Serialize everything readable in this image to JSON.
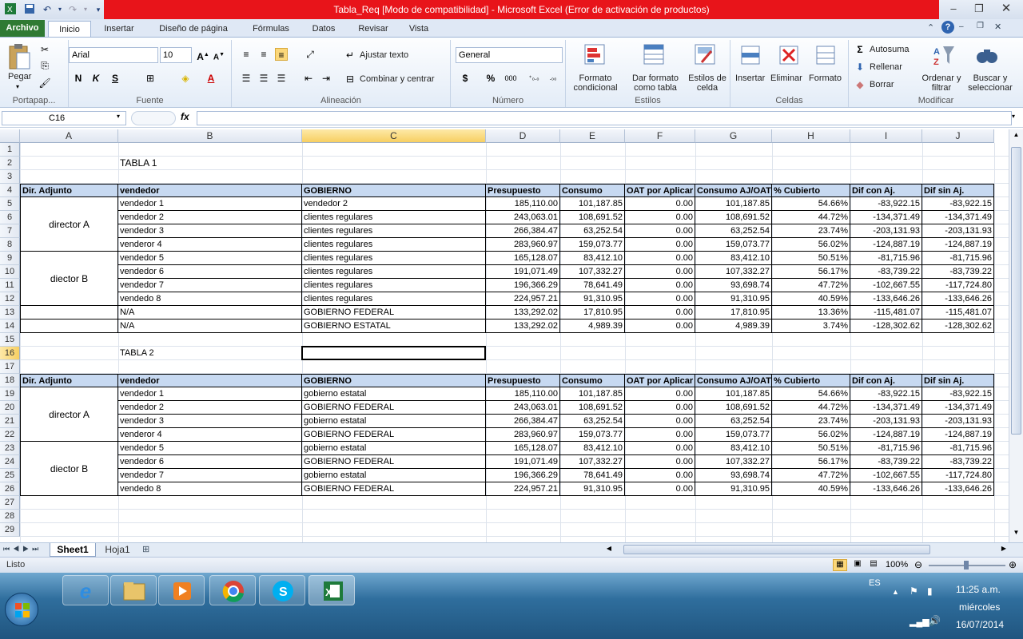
{
  "window": {
    "title": "Tabla_Req  [Modo de compatibilidad]  -  Microsoft Excel (Error de activación de productos)"
  },
  "ribbon_tabs": [
    "Archivo",
    "Inicio",
    "Insertar",
    "Diseño de página",
    "Fórmulas",
    "Datos",
    "Revisar",
    "Vista"
  ],
  "ribbon": {
    "clipboard": {
      "paste": "Pegar",
      "group": "Portapap..."
    },
    "font": {
      "name": "Arial",
      "size": "10",
      "group": "Fuente"
    },
    "alignment": {
      "wrap": "Ajustar texto",
      "merge": "Combinar y centrar",
      "group": "Alineación"
    },
    "number": {
      "format": "General",
      "group": "Número"
    },
    "styles": {
      "cond": "Formato condicional",
      "table": "Dar formato como tabla",
      "cellstyles": "Estilos de celda",
      "group": "Estilos"
    },
    "cells": {
      "insert": "Insertar",
      "delete": "Eliminar",
      "format": "Formato",
      "group": "Celdas"
    },
    "editing": {
      "autosum": "Autosuma",
      "fill": "Rellenar",
      "clear": "Borrar",
      "sort": "Ordenar y filtrar",
      "find": "Buscar y seleccionar",
      "group": "Modificar"
    }
  },
  "formula_bar": {
    "name_box": "C16",
    "fx": "fx",
    "value": ""
  },
  "columns": [
    "A",
    "B",
    "C",
    "D",
    "E",
    "F",
    "G",
    "H",
    "I",
    "J"
  ],
  "rows": [
    "1",
    "2",
    "3",
    "4",
    "5",
    "6",
    "7",
    "8",
    "9",
    "10",
    "11",
    "12",
    "13",
    "14",
    "15",
    "16",
    "17",
    "18",
    "19",
    "20",
    "21",
    "22",
    "23",
    "24",
    "25",
    "26",
    "27",
    "28",
    "29"
  ],
  "sheet": {
    "table1_title": "TABLA 1",
    "table2_title": "TABLA 2",
    "headers": [
      "Dir. Adjunto",
      "vendedor",
      "GOBIERNO",
      "Presupuesto",
      "Consumo",
      "OAT por Aplicar",
      "Consumo AJ/OAT",
      "% Cubierto",
      "Dif con Aj.",
      "Dif sin Aj."
    ],
    "director_a": "director A",
    "director_b1": "diector B",
    "director_b2": "diector B",
    "table1": [
      [
        "vendedor 1",
        "vendedor 2",
        "185,110.00",
        "101,187.85",
        "0.00",
        "101,187.85",
        "54.66%",
        "-83,922.15",
        "-83,922.15"
      ],
      [
        "vendedor 2",
        "clientes regulares",
        "243,063.01",
        "108,691.52",
        "0.00",
        "108,691.52",
        "44.72%",
        "-134,371.49",
        "-134,371.49"
      ],
      [
        "vendedor 3",
        "clientes regulares",
        "266,384.47",
        "63,252.54",
        "0.00",
        "63,252.54",
        "23.74%",
        "-203,131.93",
        "-203,131.93"
      ],
      [
        "venderor 4",
        "clientes regulares",
        "283,960.97",
        "159,073.77",
        "0.00",
        "159,073.77",
        "56.02%",
        "-124,887.19",
        "-124,887.19"
      ],
      [
        "vendedor 5",
        "clientes regulares",
        "165,128.07",
        "83,412.10",
        "0.00",
        "83,412.10",
        "50.51%",
        "-81,715.96",
        "-81,715.96"
      ],
      [
        "vendedor 6",
        "clientes regulares",
        "191,071.49",
        "107,332.27",
        "0.00",
        "107,332.27",
        "56.17%",
        "-83,739.22",
        "-83,739.22"
      ],
      [
        "vendedor 7",
        "clientes regulares",
        "196,366.29",
        "78,641.49",
        "0.00",
        "93,698.74",
        "47.72%",
        "-102,667.55",
        "-117,724.80"
      ],
      [
        "vendedo 8",
        "clientes regulares",
        "224,957.21",
        "91,310.95",
        "0.00",
        "91,310.95",
        "40.59%",
        "-133,646.26",
        "-133,646.26"
      ],
      [
        "N/A",
        "GOBIERNO FEDERAL",
        "133,292.02",
        "17,810.95",
        "0.00",
        "17,810.95",
        "13.36%",
        "-115,481.07",
        "-115,481.07"
      ],
      [
        "N/A",
        "GOBIERNO ESTATAL",
        "133,292.02",
        "4,989.39",
        "0.00",
        "4,989.39",
        "3.74%",
        "-128,302.62",
        "-128,302.62"
      ]
    ],
    "table2": [
      [
        "vendedor 1",
        "gobierno estatal",
        "185,110.00",
        "101,187.85",
        "0.00",
        "101,187.85",
        "54.66%",
        "-83,922.15",
        "-83,922.15"
      ],
      [
        "vendedor 2",
        "GOBIERNO FEDERAL",
        "243,063.01",
        "108,691.52",
        "0.00",
        "108,691.52",
        "44.72%",
        "-134,371.49",
        "-134,371.49"
      ],
      [
        "vendedor 3",
        "gobierno estatal",
        "266,384.47",
        "63,252.54",
        "0.00",
        "63,252.54",
        "23.74%",
        "-203,131.93",
        "-203,131.93"
      ],
      [
        "venderor 4",
        "GOBIERNO FEDERAL",
        "283,960.97",
        "159,073.77",
        "0.00",
        "159,073.77",
        "56.02%",
        "-124,887.19",
        "-124,887.19"
      ],
      [
        "vendedor 5",
        "gobierno estatal",
        "165,128.07",
        "83,412.10",
        "0.00",
        "83,412.10",
        "50.51%",
        "-81,715.96",
        "-81,715.96"
      ],
      [
        "vendedor 6",
        "GOBIERNO FEDERAL",
        "191,071.49",
        "107,332.27",
        "0.00",
        "107,332.27",
        "56.17%",
        "-83,739.22",
        "-83,739.22"
      ],
      [
        "vendedor 7",
        "gobierno estatal",
        "196,366.29",
        "78,641.49",
        "0.00",
        "93,698.74",
        "47.72%",
        "-102,667.55",
        "-117,724.80"
      ],
      [
        "vendedo 8",
        "GOBIERNO FEDERAL",
        "224,957.21",
        "91,310.95",
        "0.00",
        "91,310.95",
        "40.59%",
        "-133,646.26",
        "-133,646.26"
      ]
    ]
  },
  "sheet_tabs": [
    "Sheet1",
    "Hoja1"
  ],
  "status": {
    "ready": "Listo",
    "zoom": "100%"
  },
  "taskbar": {
    "lang": "ES",
    "time": "11:25 a.m.",
    "day": "miércoles",
    "date": "16/07/2014"
  },
  "colors": {
    "header_fill": "#c7d9f1",
    "title_red": "#e8141a",
    "file_tab": "#2f7a33"
  }
}
